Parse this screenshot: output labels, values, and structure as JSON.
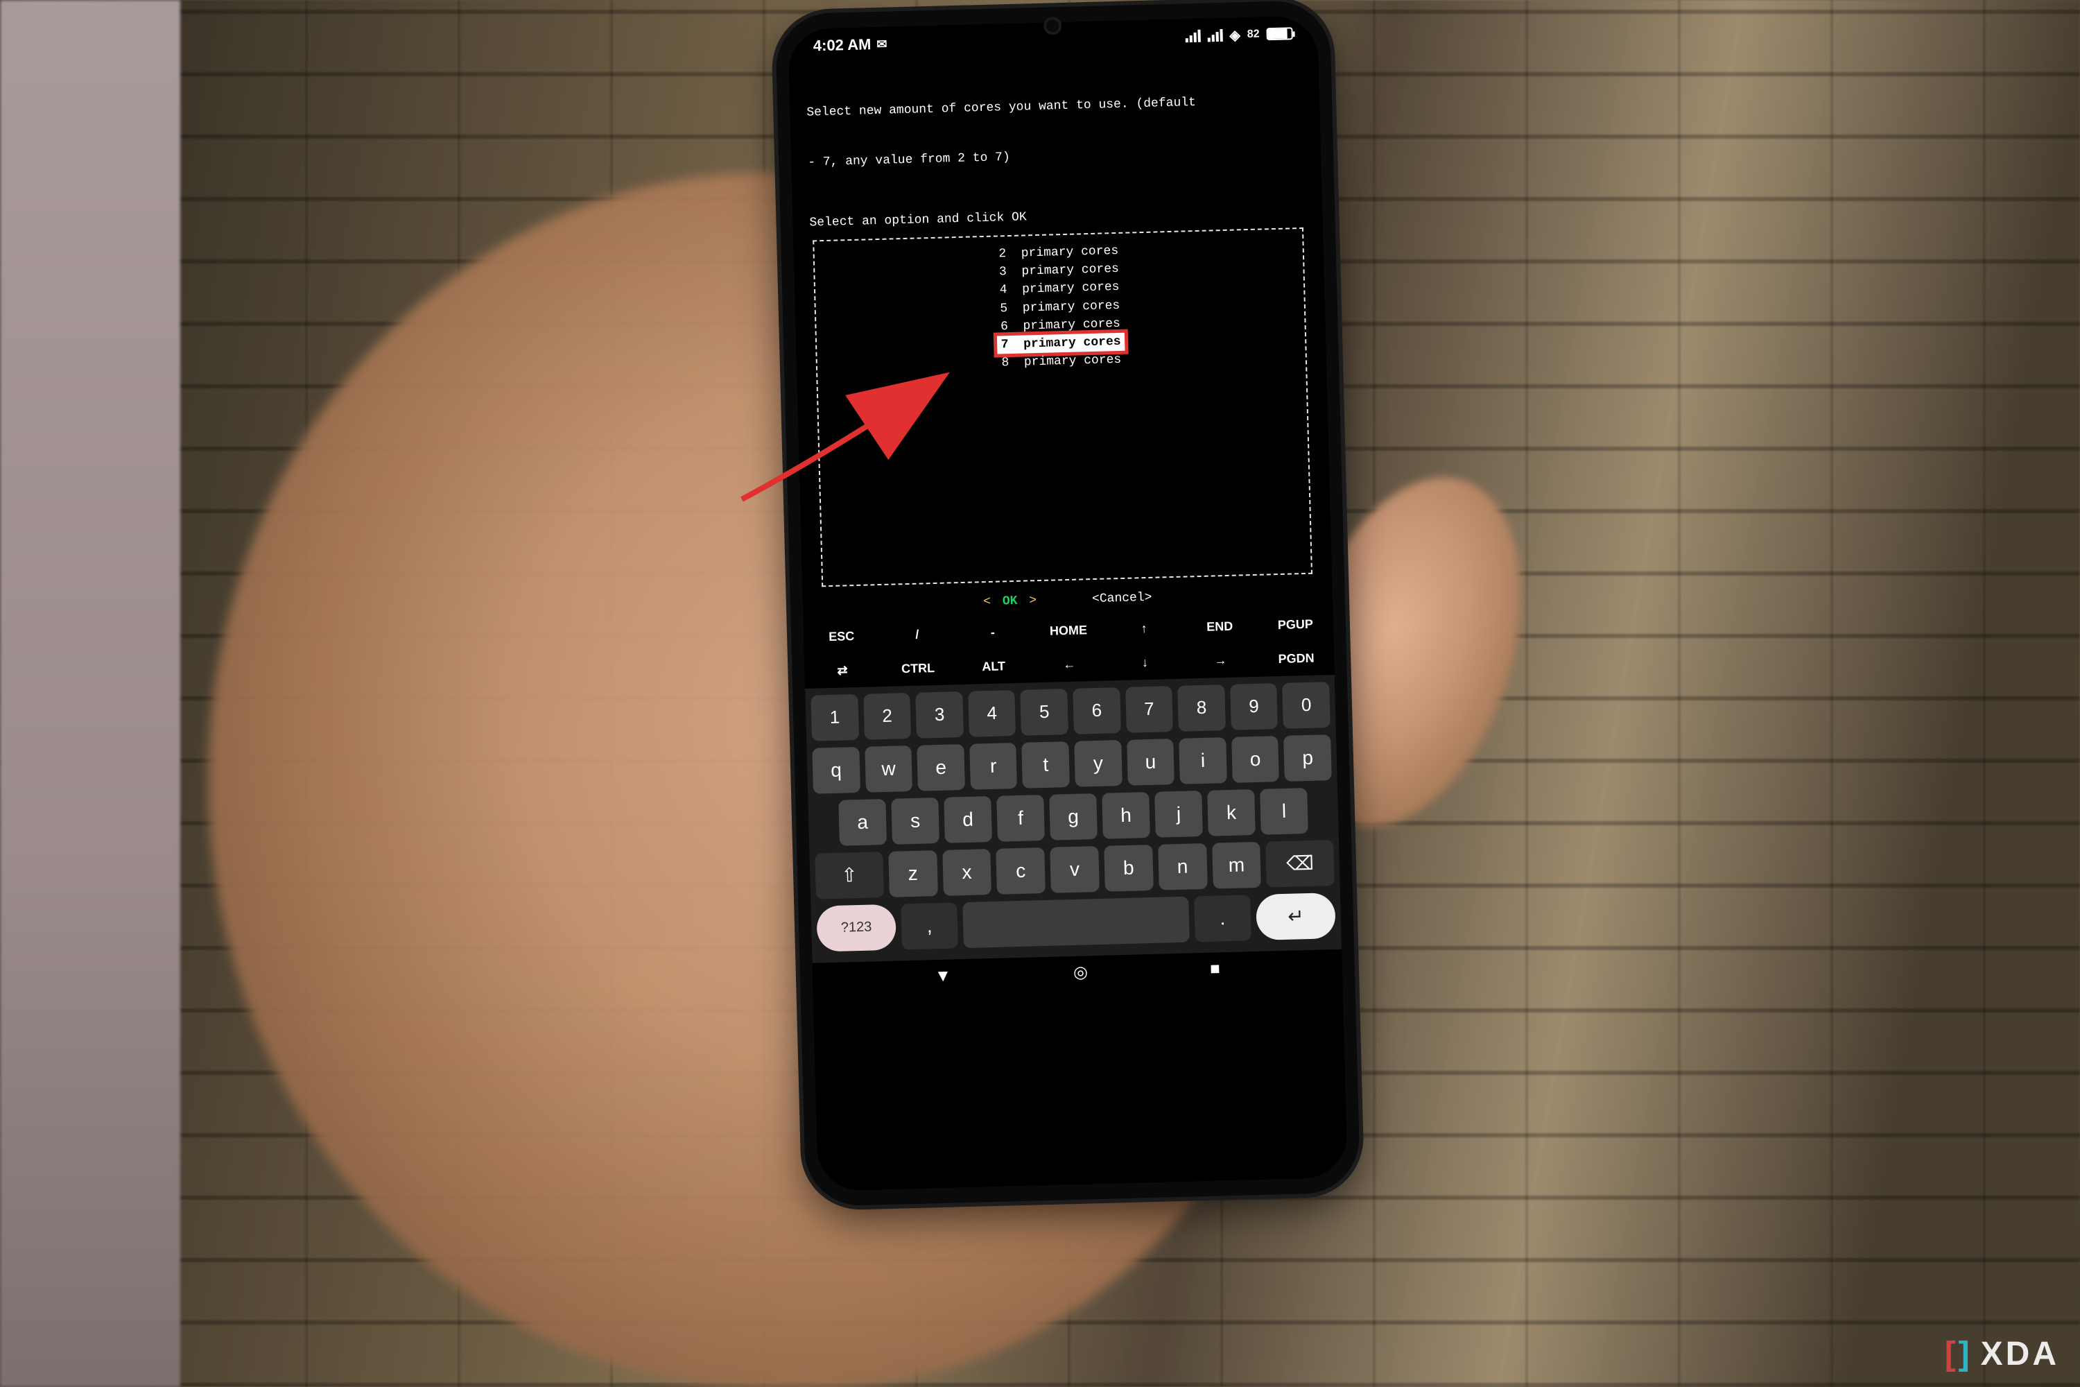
{
  "status": {
    "time": "4:02 AM",
    "message_icon": "message-icon",
    "battery_percent": "82"
  },
  "terminal": {
    "prompt_line1": "Select new amount of cores you want to use. (default",
    "prompt_line2": "- 7, any value from 2 to 7)",
    "instruction": "Select an option and click OK",
    "options": [
      {
        "n": "2",
        "label": "primary cores",
        "selected": false
      },
      {
        "n": "3",
        "label": "primary cores",
        "selected": false
      },
      {
        "n": "4",
        "label": "primary cores",
        "selected": false
      },
      {
        "n": "5",
        "label": "primary cores",
        "selected": false
      },
      {
        "n": "6",
        "label": "primary cores",
        "selected": false
      },
      {
        "n": "7",
        "label": "primary cores",
        "selected": true
      },
      {
        "n": "8",
        "label": "primary cores",
        "selected": false
      }
    ],
    "ok_left": "<",
    "ok_label": "OK",
    "ok_right": ">",
    "cancel_label": "<Cancel>"
  },
  "extra_keys_row1": [
    "ESC",
    "/",
    "-",
    "HOME",
    "↑",
    "END",
    "PGUP"
  ],
  "extra_keys_row2": [
    "⇄",
    "CTRL",
    "ALT",
    "←",
    "↓",
    "→",
    "PGDN"
  ],
  "keyboard": {
    "numbers": [
      "1",
      "2",
      "3",
      "4",
      "5",
      "6",
      "7",
      "8",
      "9",
      "0"
    ],
    "row1": [
      "q",
      "w",
      "e",
      "r",
      "t",
      "y",
      "u",
      "i",
      "o",
      "p"
    ],
    "row2": [
      "a",
      "s",
      "d",
      "f",
      "g",
      "h",
      "j",
      "k",
      "l"
    ],
    "row3": [
      "z",
      "x",
      "c",
      "v",
      "b",
      "n",
      "m"
    ],
    "shift": "⇧",
    "backspace": "⌫",
    "symbols": "?123",
    "comma": ",",
    "period": ".",
    "enter": "↵"
  },
  "watermark": {
    "left": "[",
    "right": "]",
    "text": "XDA"
  }
}
